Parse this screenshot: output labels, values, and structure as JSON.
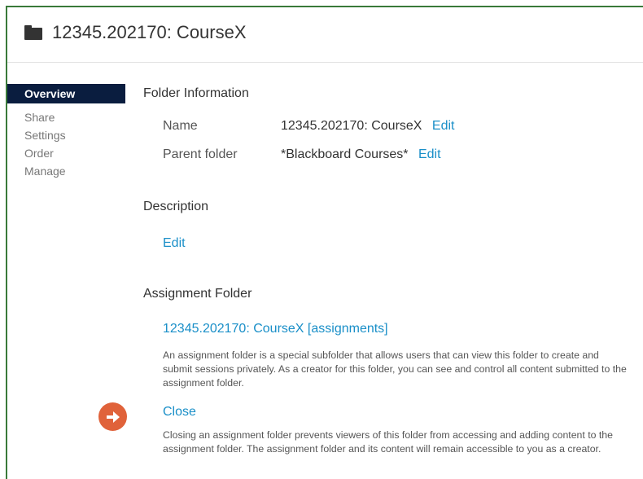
{
  "header": {
    "title": "12345.202170: CourseX",
    "icon": "folder-icon"
  },
  "nav": {
    "items": [
      {
        "label": "Overview",
        "active": true
      },
      {
        "label": "Share"
      },
      {
        "label": "Settings"
      },
      {
        "label": "Order"
      },
      {
        "label": "Manage"
      }
    ]
  },
  "folder_info": {
    "heading": "Folder Information",
    "name_label": "Name",
    "name_value": "12345.202170: CourseX",
    "name_edit": "Edit",
    "parent_label": "Parent folder",
    "parent_value": "*Blackboard Courses*",
    "parent_edit": "Edit"
  },
  "description": {
    "heading": "Description",
    "edit": "Edit"
  },
  "assignment": {
    "heading": "Assignment Folder",
    "link": "12345.202170: CourseX [assignments]",
    "text": "An assignment folder is a special subfolder that allows users that can view this folder to create and submit sessions privately. As a creator for this folder, you can see and control all content submitted to the assignment folder.",
    "close_label": "Close",
    "close_text": "Closing an assignment folder prevents viewers of this folder from accessing and adding content to the assignment folder. The assignment folder and its content will remain accessible to you as a creator."
  },
  "colors": {
    "accent": "#1a8fc8",
    "nav_active": "#0a1d3f",
    "arrow": "#e0623a",
    "border": "#3a7a3a"
  }
}
